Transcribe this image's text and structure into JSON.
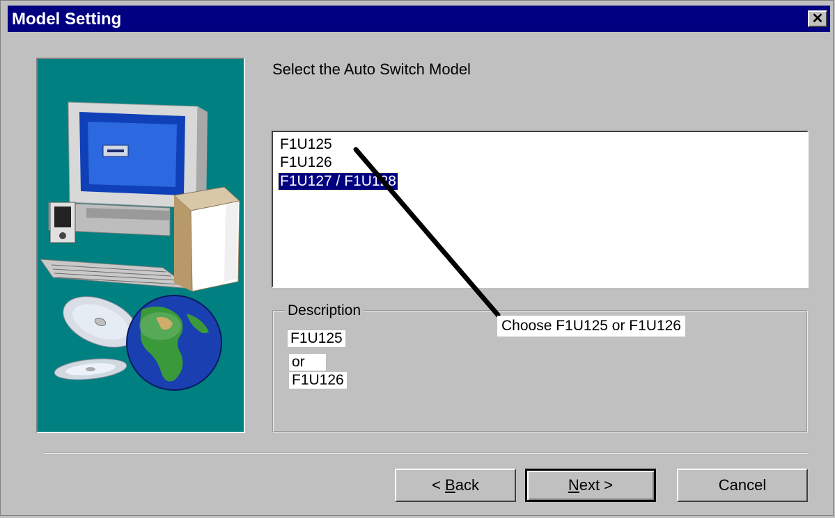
{
  "window": {
    "title": "Model Setting",
    "close_glyph": "✕"
  },
  "prompt": "Select the Auto Switch Model",
  "models": {
    "items": [
      "F1U125",
      "F1U126",
      "F1U127 / F1U128"
    ],
    "selected_index": 2
  },
  "description": {
    "label": "Description",
    "lines": [
      "F1U125",
      "or",
      "F1U126"
    ]
  },
  "annotation": {
    "text": "Choose F1U125 or F1U126"
  },
  "buttons": {
    "back_prefix": "< ",
    "back_mnemonic": "B",
    "back_rest": "ack",
    "next_mnemonic": "N",
    "next_rest": "ext >",
    "cancel": "Cancel"
  },
  "icons": [
    "computer-illustration",
    "cd-discs-icon",
    "globe-icon"
  ],
  "colors": {
    "titlebar": "#000080",
    "panel": "#008080",
    "selection": "#000080",
    "face": "#c0c0c0"
  }
}
